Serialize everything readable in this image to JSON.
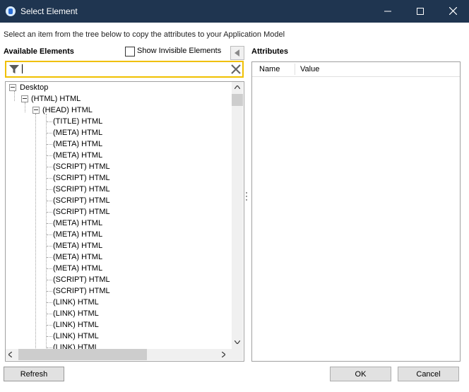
{
  "window": {
    "title": "Select Element",
    "icon": "app-icon",
    "controls": [
      "minimize-icon",
      "maximize-icon",
      "close-icon"
    ]
  },
  "instruction": "Select an item from the tree below to copy the attributes to your Application Model",
  "available": {
    "label": "Available Elements",
    "show_invisible_label": "Show Invisible Elements",
    "show_invisible_checked": false,
    "filter_value": ""
  },
  "tree": {
    "nodes": [
      "Desktop",
      "(HTML) HTML",
      "(HEAD) HTML",
      "(TITLE) HTML",
      "(META) HTML",
      "(META) HTML",
      "(META) HTML",
      "(SCRIPT) HTML",
      "(SCRIPT) HTML",
      "(SCRIPT) HTML",
      "(SCRIPT) HTML",
      "(SCRIPT) HTML",
      "(META) HTML",
      "(META) HTML",
      "(META) HTML",
      "(META) HTML",
      "(META) HTML",
      "(SCRIPT) HTML",
      "(SCRIPT) HTML",
      "(LINK) HTML",
      "(LINK) HTML",
      "(LINK) HTML",
      "(LINK) HTML",
      "(LINK) HTML"
    ]
  },
  "attributes": {
    "label": "Attributes",
    "columns": [
      "Name",
      "Value"
    ]
  },
  "buttons": {
    "refresh": "Refresh",
    "ok": "OK",
    "cancel": "Cancel"
  },
  "colors": {
    "titlebar": "#1f3550",
    "filter_border": "#f0c000"
  }
}
